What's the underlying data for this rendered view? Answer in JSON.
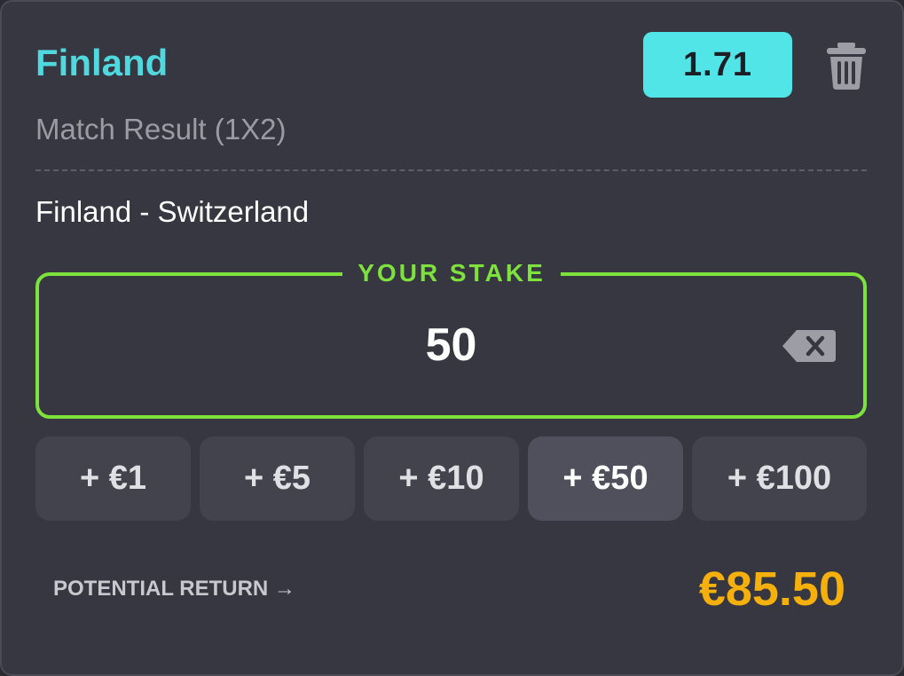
{
  "bet": {
    "selection": "Finland",
    "odds": "1.71",
    "market": "Match Result (1X2)",
    "event": "Finland - Switzerland"
  },
  "stake": {
    "label": "YOUR STAKE",
    "value": "50"
  },
  "quick_stakes": [
    {
      "label": "+ €1",
      "active": false
    },
    {
      "label": "+ €5",
      "active": false
    },
    {
      "label": "+ €10",
      "active": false
    },
    {
      "label": "+ €50",
      "active": true
    },
    {
      "label": "+ €100",
      "active": false
    }
  ],
  "potential_return": {
    "label": "POTENTIAL RETURN →",
    "value": "€85.50"
  },
  "icons": {
    "remove": "trash-icon",
    "clear_stake": "backspace-icon"
  },
  "colors": {
    "selection": "#4fd8de",
    "odds_bg": "#52e5e8",
    "stake_accent": "#7ee23c",
    "return_value": "#f5b00b",
    "card_bg": "#363741"
  }
}
